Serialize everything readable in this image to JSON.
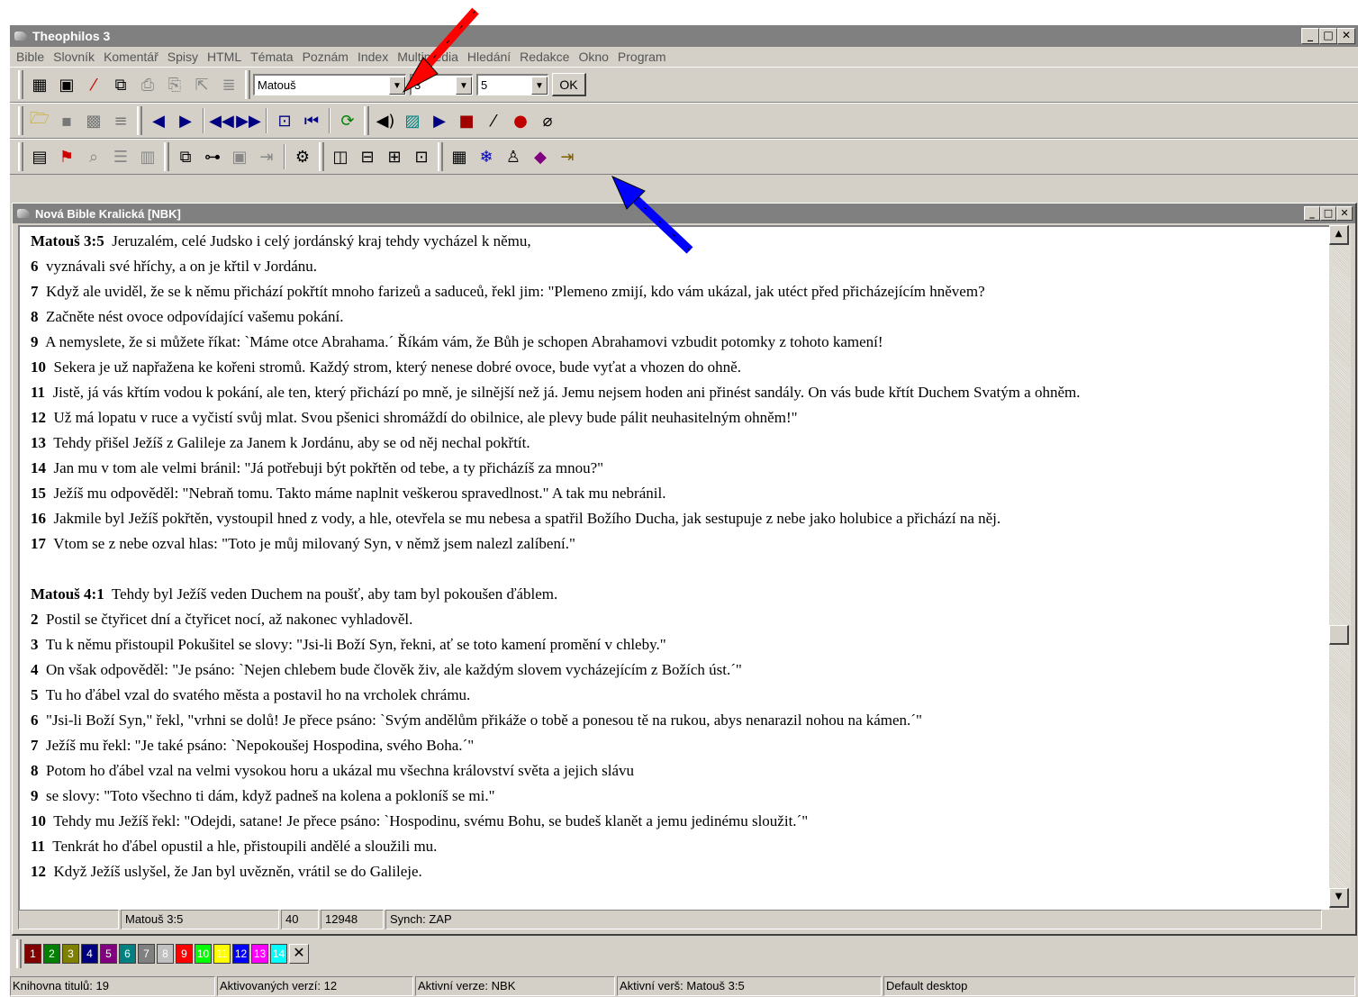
{
  "app": {
    "title": "Theophilos 3"
  },
  "menu": [
    "Bible",
    "Slovník",
    "Komentář",
    "Spisy",
    "HTML",
    "Témata",
    "Poznám",
    "Index",
    "Multimédia",
    "Hledání",
    "Redakce",
    "Okno",
    "Program"
  ],
  "nav": {
    "book": "Matouš",
    "chapter": "3",
    "verse": "5",
    "ok_label": "OK"
  },
  "icons": {
    "row1": [
      "books-icon",
      "bible-icon",
      "pen-icon",
      "copy-icon",
      "print-icon",
      "print-preview-icon",
      "bookmark-icon",
      "note-icon"
    ],
    "row2": [
      "open-folder-icon",
      "save-icon",
      "save-all-icon",
      "add-icon",
      "prev-icon",
      "next-icon",
      "first-icon",
      "last-icon",
      "back-icon",
      "back-start-icon",
      "refresh-icon",
      "sound-icon",
      "image-icon",
      "play-icon",
      "stop-icon",
      "microphone-icon",
      "record-icon",
      "attach-icon"
    ],
    "row3": [
      "verse-list-icon",
      "tag-icon",
      "find-icon",
      "outline-icon",
      "compare-icon",
      "copy-text-icon",
      "tree-icon",
      "paste-icon",
      "export-icon",
      "options-icon",
      "columns-icon",
      "rows-icon",
      "grid-icon",
      "window-icon",
      "properties-icon",
      "snowflake-icon",
      "person-icon",
      "book-icon",
      "exit-icon"
    ]
  },
  "window": {
    "title": "Nová Bible Kralická [NBK]"
  },
  "verses": [
    {
      "ref": "Matouš 3:5",
      "text": "Jeruzalém, celé Judsko i celý jordánský kraj tehdy vycházel k němu,"
    },
    {
      "ref": "6",
      "text": "vyznávali své hříchy, a on je křtil v Jordánu."
    },
    {
      "ref": "7",
      "text": "Když ale uviděl, že se k němu přichází pokřtít mnoho farizeů a saduceů, řekl jim: \"Plemeno zmijí, kdo vám ukázal, jak utéct před přicházejícím hněvem?"
    },
    {
      "ref": "8",
      "text": "Začněte nést ovoce odpovídající vašemu pokání."
    },
    {
      "ref": "9",
      "text": "A nemyslete, že si můžete říkat: `Máme otce Abrahama.´ Říkám vám, že Bůh je schopen Abrahamovi vzbudit potomky z tohoto kamení!"
    },
    {
      "ref": "10",
      "text": "Sekera je už napřažena ke kořeni stromů. Každý strom, který nenese dobré ovoce, bude vyťat a vhozen do ohně."
    },
    {
      "ref": "11",
      "text": "Jistě, já vás křtím vodou k pokání, ale ten, který přichází po mně, je silnější než já. Jemu nejsem hoden ani přinést sandály. On vás bude křtít Duchem Svatým a ohněm."
    },
    {
      "ref": "12",
      "text": "Už má lopatu v ruce a vyčistí svůj mlat. Svou pšenici shromáždí do obilnice, ale plevy bude pálit neuhasitelným ohněm!\""
    },
    {
      "ref": "13",
      "text": "Tehdy přišel Ježíš z Galileje za Janem k Jordánu, aby se od něj nechal pokřtít."
    },
    {
      "ref": "14",
      "text": "Jan mu v tom ale velmi bránil: \"Já potřebuji být pokřtěn od tebe, a ty přicházíš za mnou?\""
    },
    {
      "ref": "15",
      "text": "Ježíš mu odpověděl: \"Nebraň tomu. Takto máme naplnit veškerou spravedlnost.\" A tak mu nebránil."
    },
    {
      "ref": "16",
      "text": "Jakmile byl Ježíš pokřtěn, vystoupil hned z vody, a hle, otevřela se mu nebesa a spatřil Božího Ducha, jak sestupuje z nebe jako holubice a přichází na něj."
    },
    {
      "ref": "17",
      "text": "Vtom se z nebe ozval hlas: \"Toto je můj milovaný Syn, v němž jsem nalezl zalíbení.\""
    },
    {
      "ref": "Matouš 4:1",
      "text": "Tehdy byl Ježíš veden Duchem na poušť, aby tam byl pokoušen ďáblem."
    },
    {
      "ref": "2",
      "text": "Postil se čtyřicet dní a čtyřicet nocí, až nakonec vyhladověl."
    },
    {
      "ref": "3",
      "text": "Tu k němu přistoupil Pokušitel se slovy: \"Jsi-li Boží Syn, řekni, ať se toto kamení promění v chleby.\""
    },
    {
      "ref": "4",
      "text": "On však odpověděl: \"Je psáno: `Nejen chlebem bude člověk živ, ale každým slovem vycházejícím z Božích úst.´\""
    },
    {
      "ref": "5",
      "text": "Tu ho ďábel vzal do svatého města a postavil ho na vrcholek chrámu."
    },
    {
      "ref": "6",
      "text": "\"Jsi-li Boží Syn,\" řekl, \"vrhni se dolů! Je přece psáno: `Svým andělům přikáže o tobě a ponesou tě na rukou, abys nenarazil nohou na kámen.´\""
    },
    {
      "ref": "7",
      "text": "Ježíš mu řekl: \"Je také psáno: `Nepokoušej Hospodina, svého Boha.´\""
    },
    {
      "ref": "8",
      "text": "Potom ho ďábel vzal na velmi vysokou horu a ukázal mu všechna království světa a jejich slávu"
    },
    {
      "ref": "9",
      "text": "se slovy: \"Toto všechno ti dám, když padneš na kolena a pokloníš se mi.\""
    },
    {
      "ref": "10",
      "text": "Tehdy mu Ježíš řekl: \"Odejdi, satane! Je přece psáno: `Hospodinu, svému Bohu, se budeš klanět a jemu jedinému sloužit.´\""
    },
    {
      "ref": "11",
      "text": "Tenkrát ho ďábel opustil a hle, přistoupili andělé a sloužili mu."
    },
    {
      "ref": "12",
      "text": "Když Ježíš uslyšel, že Jan byl uvězněn, vrátil se do Galileje."
    }
  ],
  "window_status": {
    "cell1": "",
    "ref": "Matouš 3:5",
    "count1": "40",
    "count2": "12948",
    "synch": "Synch: ZAP"
  },
  "color_tabs": [
    {
      "label": "1",
      "color": "#800000"
    },
    {
      "label": "2",
      "color": "#008000"
    },
    {
      "label": "3",
      "color": "#808000"
    },
    {
      "label": "4",
      "color": "#000080"
    },
    {
      "label": "5",
      "color": "#800080"
    },
    {
      "label": "6",
      "color": "#008080"
    },
    {
      "label": "7",
      "color": "#808080"
    },
    {
      "label": "8",
      "color": "#c0c0c0"
    },
    {
      "label": "9",
      "color": "#ff0000"
    },
    {
      "label": "10",
      "color": "#00ff00"
    },
    {
      "label": "11",
      "color": "#ffff00"
    },
    {
      "label": "12",
      "color": "#0000ff"
    },
    {
      "label": "13",
      "color": "#ff00ff"
    },
    {
      "label": "14",
      "color": "#00ffff"
    }
  ],
  "close_label": "✕",
  "status": {
    "library": "Knihovna titulů: 19",
    "activated": "Aktivovaných verzí: 12",
    "active_version": "Aktivní verze: NBK",
    "active_verse": "Aktivní verš: Matouš 3:5",
    "desktop": "Default desktop"
  },
  "colors": {
    "arrow_red": "#ff0000",
    "arrow_blue": "#0000ff",
    "window_bg": "#d4d0c8",
    "titlebar": "#808080"
  }
}
